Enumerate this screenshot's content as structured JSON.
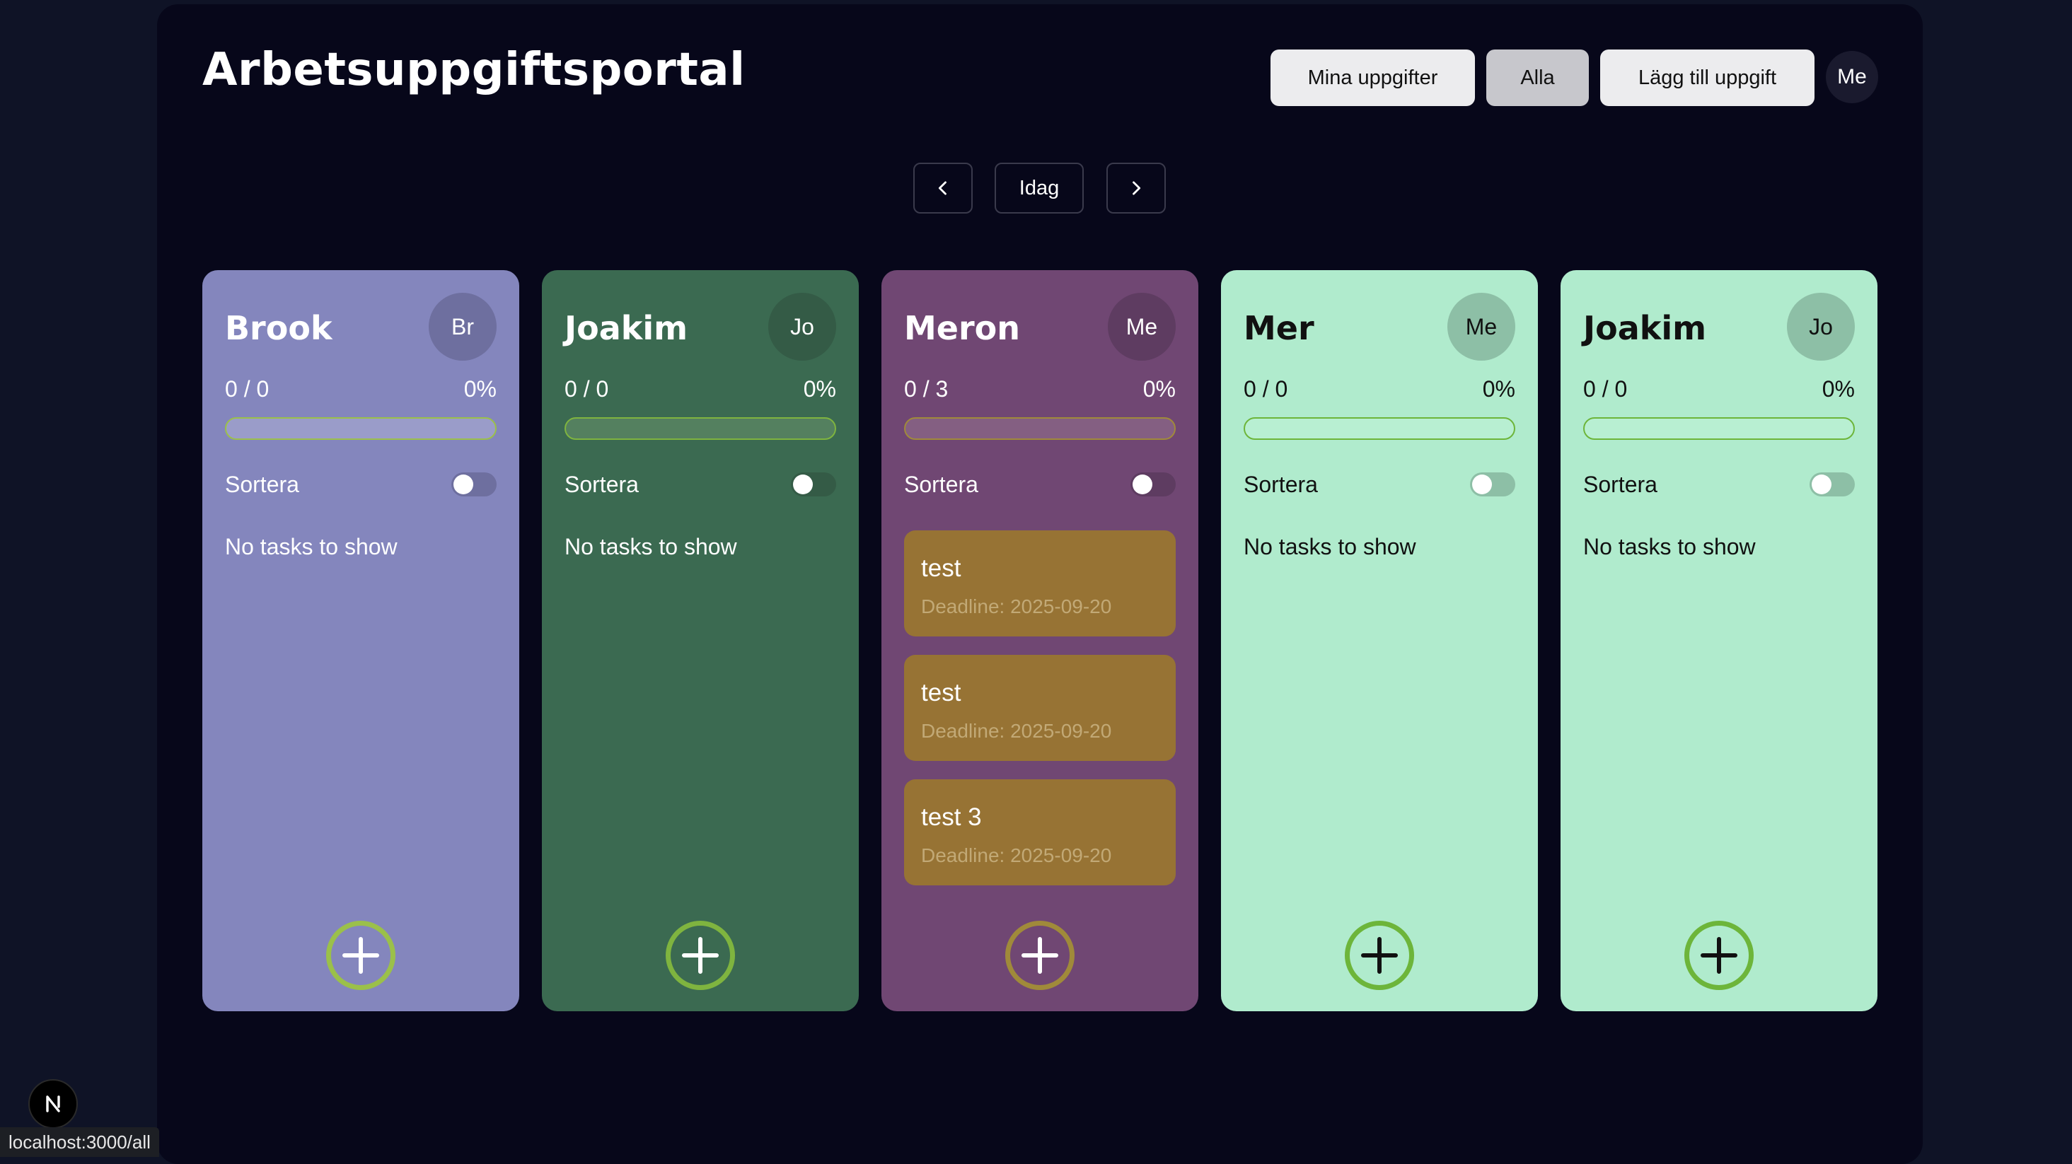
{
  "header": {
    "title": "Arbetsuppgiftsportal",
    "my_tasks_label": "Mina uppgifter",
    "all_label": "Alla",
    "add_task_label": "Lägg till uppgift",
    "user_avatar": "Me"
  },
  "date_nav": {
    "prev_icon": "chevron-left-icon",
    "today_label": "Idag",
    "next_icon": "chevron-right-icon"
  },
  "columns": [
    {
      "name": "Brook",
      "initials": "Br",
      "count": "0 / 0",
      "percent": "0%",
      "progress": 0,
      "sort_label": "Sortera",
      "sort_enabled": false,
      "empty_text": "No tasks to show",
      "tasks": [],
      "colors": {
        "bg": "#8486bd",
        "text": "#ffffff",
        "avatar": "#6e6f9f",
        "accent": "#9bc04a",
        "track": "#9a9cc9"
      }
    },
    {
      "name": "Joakim",
      "initials": "Jo",
      "count": "0 / 0",
      "percent": "0%",
      "progress": 0,
      "sort_label": "Sortera",
      "sort_enabled": false,
      "empty_text": "No tasks to show",
      "tasks": [],
      "colors": {
        "bg": "#3b6a51",
        "text": "#ffffff",
        "avatar": "#345b46",
        "accent": "#7fb43f",
        "track": "#54805f"
      }
    },
    {
      "name": "Meron",
      "initials": "Me",
      "count": "0 / 3",
      "percent": "0%",
      "progress": 0,
      "sort_label": "Sortera",
      "sort_enabled": false,
      "empty_text": "",
      "tasks": [
        {
          "title": "test",
          "deadline": "Deadline: 2025-09-20"
        },
        {
          "title": "test",
          "deadline": "Deadline: 2025-09-20"
        },
        {
          "title": "test 3",
          "deadline": "Deadline: 2025-09-20"
        }
      ],
      "colors": {
        "bg": "#704773",
        "text": "#ffffff",
        "avatar": "#5e3c61",
        "accent": "#a08a3a",
        "track": "#845f82"
      }
    },
    {
      "name": "Mer",
      "initials": "Me",
      "count": "0 / 0",
      "percent": "0%",
      "progress": 0,
      "sort_label": "Sortera",
      "sort_enabled": false,
      "empty_text": "No tasks to show",
      "tasks": [],
      "colors": {
        "bg": "#b0ebcd",
        "text": "#111111",
        "avatar": "#8dbfa6",
        "accent": "#6db53a",
        "track": "#b8efd2"
      }
    },
    {
      "name": "Joakim",
      "initials": "Jo",
      "count": "0 / 0",
      "percent": "0%",
      "progress": 0,
      "sort_label": "Sortera",
      "sort_enabled": false,
      "empty_text": "No tasks to show",
      "tasks": [],
      "colors": {
        "bg": "#b0ebcd",
        "text": "#111111",
        "avatar": "#8dbfa6",
        "accent": "#6db53a",
        "track": "#b8efd2"
      }
    }
  ],
  "add_icon": "plus-circle-icon",
  "status_bar": {
    "url": "localhost:3000/all",
    "badge_icon": "nextjs-logo-icon"
  }
}
